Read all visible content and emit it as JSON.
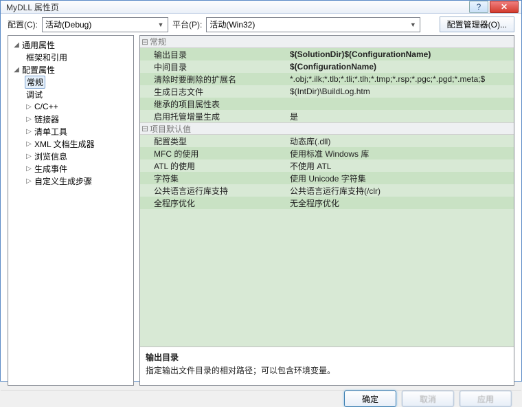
{
  "window": {
    "title": "MyDLL 属性页"
  },
  "toolbar": {
    "config_label": "配置(C):",
    "config_value": "活动(Debug)",
    "platform_label": "平台(P):",
    "platform_value": "活动(Win32)",
    "config_mgr": "配置管理器(O)..."
  },
  "tree": {
    "common": "通用属性",
    "framework": "框架和引用",
    "config_props": "配置属性",
    "general": "常规",
    "debug": "调试",
    "cpp": "C/C++",
    "linker": "链接器",
    "manifest": "清单工具",
    "xml_doc": "XML 文档生成器",
    "browse": "浏览信息",
    "build_events": "生成事件",
    "custom_build": "自定义生成步骤"
  },
  "sections": {
    "general": "常规",
    "defaults": "项目默认值"
  },
  "props": {
    "out_dir": {
      "name": "输出目录",
      "value": "$(SolutionDir)$(ConfigurationName)"
    },
    "int_dir": {
      "name": "中间目录",
      "value": "$(ConfigurationName)"
    },
    "clean_ext": {
      "name": "清除时要删除的扩展名",
      "value": "*.obj;*.ilk;*.tlb;*.tli;*.tlh;*.tmp;*.rsp;*.pgc;*.pgd;*.meta;$"
    },
    "build_log": {
      "name": "生成日志文件",
      "value": "$(IntDir)\\BuildLog.htm"
    },
    "inherited": {
      "name": "继承的项目属性表",
      "value": ""
    },
    "managed_inc": {
      "name": "启用托管增量生成",
      "value": "是"
    },
    "cfg_type": {
      "name": "配置类型",
      "value": "动态库(.dll)"
    },
    "mfc": {
      "name": "MFC 的使用",
      "value": "使用标准 Windows 库"
    },
    "atl": {
      "name": "ATL 的使用",
      "value": "不使用 ATL"
    },
    "charset": {
      "name": "字符集",
      "value": "使用 Unicode 字符集"
    },
    "clr": {
      "name": "公共语言运行库支持",
      "value": "公共语言运行库支持(/clr)"
    },
    "wpo": {
      "name": "全程序优化",
      "value": "无全程序优化"
    }
  },
  "desc": {
    "title": "输出目录",
    "text": "指定输出文件目录的相对路径；可以包含环境变量。"
  },
  "footer": {
    "ok": "确定",
    "cancel": "取消",
    "apply": "应用"
  }
}
